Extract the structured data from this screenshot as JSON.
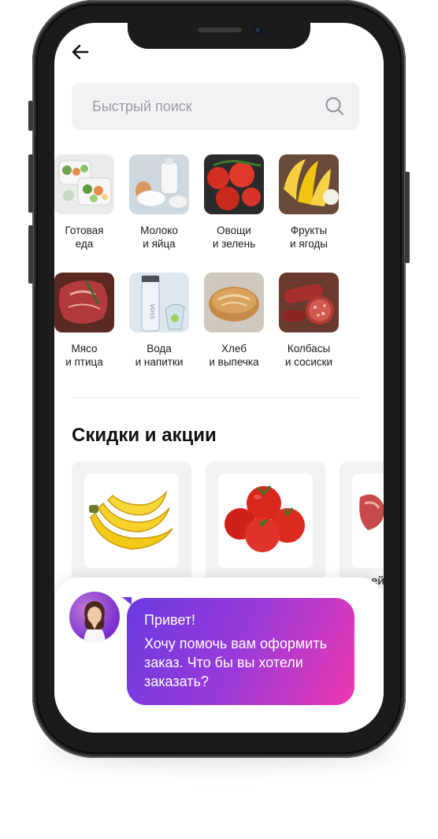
{
  "header": {
    "back_icon": "arrow-left-icon"
  },
  "search": {
    "placeholder": "Быстрый поиск",
    "icon": "search-icon"
  },
  "categories": [
    {
      "label": "Готовая\nеда",
      "icon": "ready-meal-image"
    },
    {
      "label": "Молоко\nи яйца",
      "icon": "milk-eggs-image"
    },
    {
      "label": "Овощи\nи зелень",
      "icon": "vegetables-image"
    },
    {
      "label": "Фрукты\nи ягоды",
      "icon": "fruits-image"
    },
    {
      "label": "Мясо\nи птица",
      "icon": "meat-image"
    },
    {
      "label": "Вода\nи напитки",
      "icon": "water-image"
    },
    {
      "label": "Хлеб\nи выпечка",
      "icon": "bread-image"
    },
    {
      "label": "Колбасы\nи сосиски",
      "icon": "sausages-image"
    }
  ],
  "discounts": {
    "title": "Скидки и акции",
    "cards": [
      {
        "icon": "bananas-image"
      },
      {
        "icon": "tomatoes-image"
      },
      {
        "icon": "meat-image"
      }
    ],
    "partial_text": "ей"
  },
  "chat": {
    "greeting": "Привет!",
    "message": "Хочу помочь вам оформить заказ. Что бы вы хотели заказать?"
  },
  "colors": {
    "accent_start": "#6a3ae0",
    "accent_end": "#ef38b0",
    "surface": "#f2f2f4"
  }
}
